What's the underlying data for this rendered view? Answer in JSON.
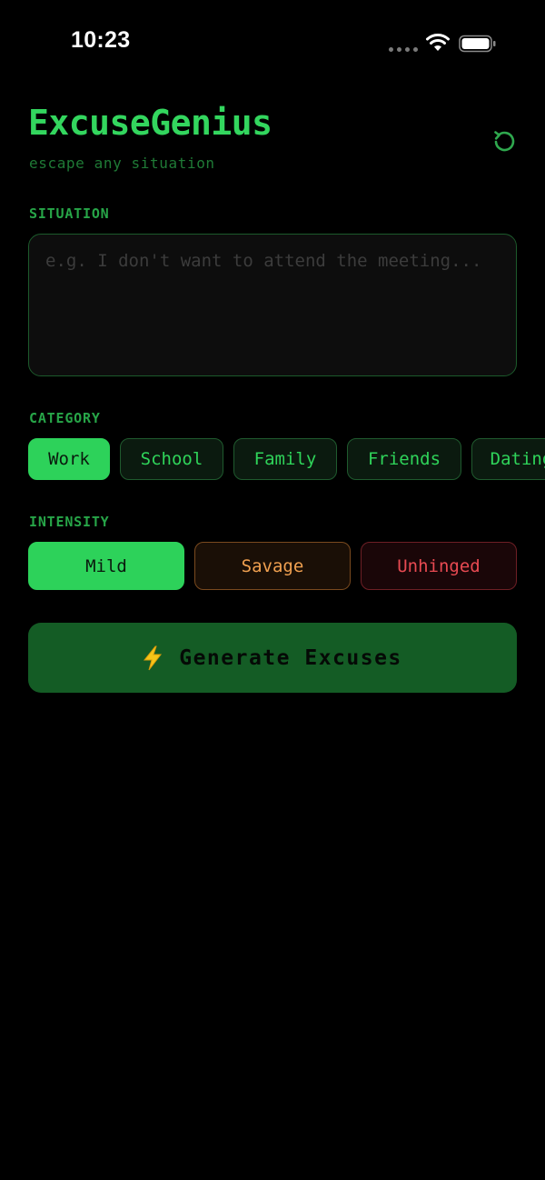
{
  "status_bar": {
    "time": "10:23"
  },
  "header": {
    "title": "ExcuseGenius",
    "subtitle": "escape any situation",
    "reset_icon": "refresh-icon"
  },
  "situation": {
    "label": "SITUATION",
    "value": "",
    "placeholder": "e.g. I don't want to attend the meeting..."
  },
  "category": {
    "label": "CATEGORY",
    "selected": "Work",
    "items": [
      "Work",
      "School",
      "Family",
      "Friends",
      "Dating"
    ]
  },
  "intensity": {
    "label": "INTENSITY",
    "selected": "Mild",
    "items": [
      "Mild",
      "Savage",
      "Unhinged"
    ]
  },
  "generate": {
    "label": "Generate Excuses",
    "icon": "lightning-bolt-icon"
  },
  "colors": {
    "background": "#000000",
    "accent_green": "#2dd25a",
    "button_green": "#145c25",
    "savage_orange": "#f0a050",
    "unhinged_red": "#e84a52"
  }
}
